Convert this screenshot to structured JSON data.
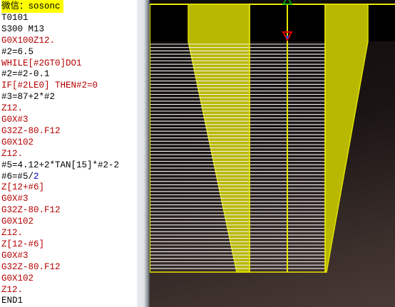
{
  "editor": {
    "lines": [
      {
        "text": "微信：sosonc",
        "color": "black",
        "highlight": true
      },
      {
        "text": "T0101",
        "color": "black"
      },
      {
        "text": "S300 M13",
        "color": "black"
      },
      {
        "text": "G0X100Z12.",
        "color": "red"
      },
      {
        "text": "#2=6.5",
        "color": "black"
      },
      {
        "text": "WHILE[#2GT0]DO1",
        "color": "red"
      },
      {
        "text": "#2=#2-0.1",
        "color": "black"
      },
      {
        "text": "IF[#2LE0] THEN#2=0",
        "color": "red"
      },
      {
        "text": "#3=87+2*#2",
        "color": "black"
      },
      {
        "text": "Z12.",
        "color": "red"
      },
      {
        "text": "G0X#3",
        "color": "red"
      },
      {
        "text": "G32Z-80.F12",
        "color": "red"
      },
      {
        "text": "G0X102",
        "color": "red"
      },
      {
        "text": "Z12.",
        "color": "red"
      },
      {
        "text": "#5=4.12+2*TAN[15]*#2-2",
        "color": "black"
      },
      {
        "text": "#6=#5/",
        "color": "black",
        "suffix": "2"
      },
      {
        "text": "Z[12+#6]",
        "color": "red"
      },
      {
        "text": "G0X#3",
        "color": "red"
      },
      {
        "text": "G32Z-80.F12",
        "color": "red"
      },
      {
        "text": "G0X102",
        "color": "red"
      },
      {
        "text": "Z12.",
        "color": "red"
      },
      {
        "text": "Z[12-#6]",
        "color": "red"
      },
      {
        "text": "G0X#3",
        "color": "red"
      },
      {
        "text": "G32Z-80.F12",
        "color": "red"
      },
      {
        "text": "G0X102",
        "color": "red"
      },
      {
        "text": "Z12.",
        "color": "red"
      },
      {
        "text": "END1",
        "color": "black"
      }
    ]
  },
  "colors": {
    "yellow": "#d6d600",
    "yellow_fill": "#a8a800",
    "toolpath": "#f2f2f2",
    "marker_green": "#00c000",
    "marker_red": "#e00000",
    "marker_blue": "#3050ff"
  },
  "icons": [
    "origin-marker-icon",
    "tool-position-icon"
  ]
}
